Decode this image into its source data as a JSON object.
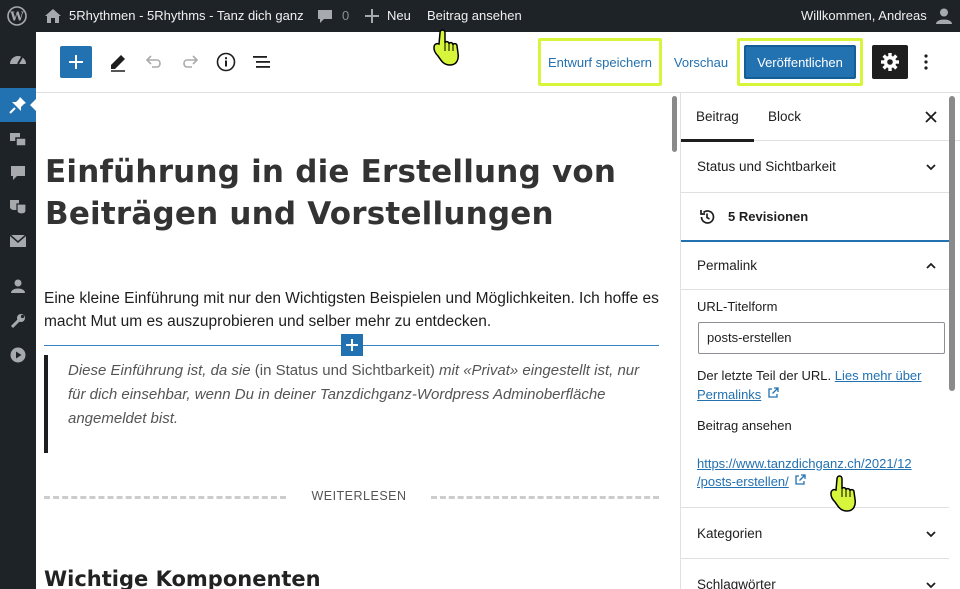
{
  "admin_bar": {
    "site_name": "5Rhythmen - 5Rhythms - Tanz dich ganz",
    "comments_count": "0",
    "new_label": "Neu",
    "view_post": "Beitrag ansehen",
    "welcome": "Willkommen, Andreas"
  },
  "toolbar": {
    "save_draft": "Entwurf speichern",
    "preview": "Vorschau",
    "publish": "Veröffentlichen"
  },
  "post": {
    "title_line1": "Einführung in die Erstellung von",
    "title_line2": "Beiträgen und Vorstellungen",
    "intro": "Eine kleine Einführung mit nur den Wichtigsten Beispielen und Möglichkeiten. Ich hoffe es macht Mut um es auszuprobieren und selber mehr zu entdecken.",
    "quote_part1": "Diese Einführung ist, da sie ",
    "quote_part2": "(in Status und Sichtbarkeit)",
    "quote_part3": " mit «Privat» eingestellt ist, nur für dich einsehbar, wenn Du in deiner Tanzdichganz-Wordpress Adminoberfläche angemeldet bist.",
    "more_label": "WEITERLESEN",
    "heading2": "Wichtige Komponenten"
  },
  "sidebar": {
    "tab_post": "Beitrag",
    "tab_block": "Block",
    "status_visibility": "Status und Sichtbarkeit",
    "revisions": "5 Revisionen",
    "permalink": "Permalink",
    "url_slug_label": "URL-Titelform",
    "url_slug_value": "posts-erstellen",
    "url_help_text": "Der letzte Teil der URL.",
    "url_help_link_1": "Lies mehr über",
    "url_help_link_2": "Permalinks",
    "view_post_label": "Beitrag ansehen",
    "post_url_line1": "https://www.tanzdichganz.ch/2021/12",
    "post_url_line2": "/posts-erstellen/",
    "categories": "Kategorien",
    "tags": "Schlagwörter"
  },
  "colors": {
    "admin_bar": "#1d2327",
    "accent": "#2271b1",
    "highlight": "#d6f53b"
  }
}
